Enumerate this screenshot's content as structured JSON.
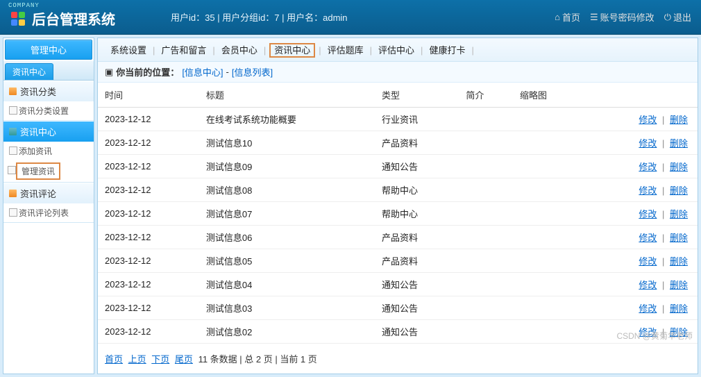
{
  "company_tag": "COMPANY",
  "header": {
    "title": "后台管理系统",
    "user_info": "用户id：35 | 用户分组id：7 | 用户名：admin",
    "links": {
      "home": "首页",
      "pwd": "账号密码修改",
      "logout": "退出"
    }
  },
  "sidebar": {
    "title": "管理中心",
    "tab": "资讯中心",
    "groups": [
      {
        "head": "资讯分类",
        "active": false,
        "items": [
          {
            "label": "资讯分类设置",
            "boxed": false
          }
        ]
      },
      {
        "head": "资讯中心",
        "active": true,
        "items": [
          {
            "label": "添加资讯",
            "boxed": false
          },
          {
            "label": "管理资讯",
            "boxed": true
          }
        ]
      },
      {
        "head": "资讯评论",
        "active": false,
        "items": [
          {
            "label": "资讯评论列表",
            "boxed": false
          }
        ]
      }
    ]
  },
  "nav": {
    "items": [
      "系统设置",
      "广告和留言",
      "会员中心",
      "资讯中心",
      "评估题库",
      "评估中心",
      "健康打卡"
    ],
    "active_index": 3
  },
  "crumb": {
    "prefix": "你当前的位置：",
    "a": "[信息中心]",
    "sep": "-",
    "b": "[信息列表]"
  },
  "table": {
    "headers": [
      "时间",
      "标题",
      "类型",
      "简介",
      "缩略图",
      ""
    ],
    "rows": [
      {
        "time": "2023-12-12",
        "title": "在线考试系统功能概要",
        "type": "行业资讯"
      },
      {
        "time": "2023-12-12",
        "title": "测试信息10",
        "type": "产品资料"
      },
      {
        "time": "2023-12-12",
        "title": "测试信息09",
        "type": "通知公告"
      },
      {
        "time": "2023-12-12",
        "title": "测试信息08",
        "type": "帮助中心"
      },
      {
        "time": "2023-12-12",
        "title": "测试信息07",
        "type": "帮助中心"
      },
      {
        "time": "2023-12-12",
        "title": "测试信息06",
        "type": "产品资料"
      },
      {
        "time": "2023-12-12",
        "title": "测试信息05",
        "type": "产品资料"
      },
      {
        "time": "2023-12-12",
        "title": "测试信息04",
        "type": "通知公告"
      },
      {
        "time": "2023-12-12",
        "title": "测试信息03",
        "type": "通知公告"
      },
      {
        "time": "2023-12-12",
        "title": "测试信息02",
        "type": "通知公告"
      }
    ],
    "actions": {
      "edit": "修改",
      "del": "删除",
      "sep": "|"
    }
  },
  "pager": {
    "first": "首页",
    "prev": "上页",
    "next": "下页",
    "last": "尾页",
    "info": "11 条数据 | 总 2 页 | 当前 1 页"
  },
  "watermark": "CSDN @黄菊华老师"
}
